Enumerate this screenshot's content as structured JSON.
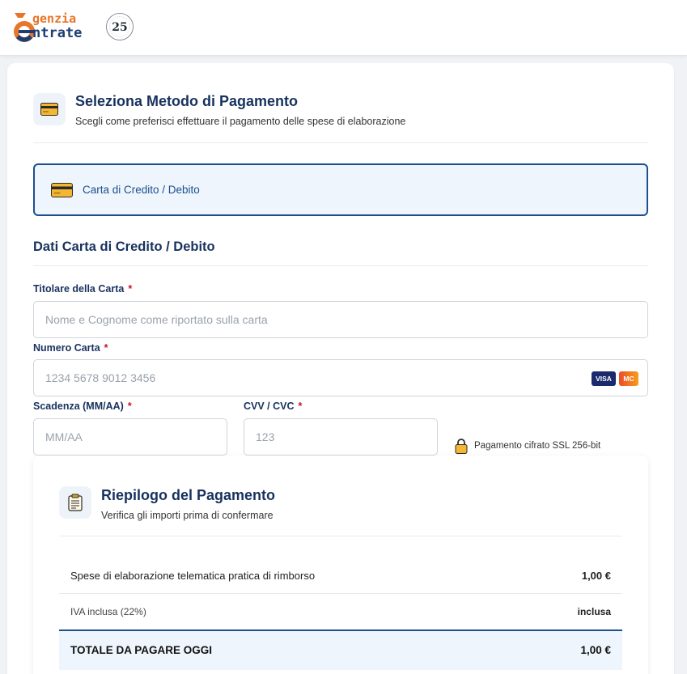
{
  "header": {
    "logo_line1": "genzia",
    "logo_line2": "ntrate",
    "seal_number": "25"
  },
  "payment_method": {
    "title": "Seleziona Metodo di Pagamento",
    "subtitle": "Scegli come preferisci effettuare il pagamento delle spese di elaborazione",
    "selected_label": "Carta di Credito / Debito",
    "icon": "credit-card-icon"
  },
  "card_form": {
    "title": "Dati Carta di Credito / Debito",
    "holder_label": "Titolare della Carta",
    "holder_placeholder": "Nome e Cognome come riportato sulla carta",
    "number_label": "Numero Carta",
    "number_placeholder": "1234 5678 9012 3456",
    "expiry_label": "Scadenza (MM/AA)",
    "expiry_placeholder": "MM/AA",
    "cvv_label": "CVV / CVC",
    "cvv_placeholder": "123",
    "required_mark": "*",
    "brand_visa": "VISA",
    "brand_mc": "MC",
    "ssl_text": "Pagamento cifrato SSL 256-bit"
  },
  "summary": {
    "title": "Riepilogo del Pagamento",
    "subtitle": "Verifica gli importi prima di confermare",
    "icon": "clipboard-icon",
    "rows": [
      {
        "label": "Spese di elaborazione telematica pratica di rimborso",
        "value": "1,00 €"
      },
      {
        "label": "IVA inclusa (22%)",
        "value": "inclusa"
      }
    ],
    "total_label": "TOTALE DA PAGARE OGGI",
    "total_value": "1,00 €"
  },
  "colors": {
    "primary": "#17325e",
    "accent": "#1d4f8f",
    "orange": "#e8752a",
    "required": "#c0182d"
  }
}
